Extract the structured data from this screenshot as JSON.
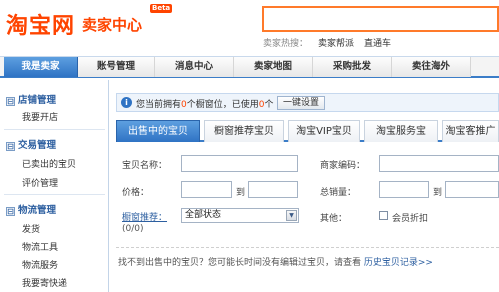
{
  "header": {
    "logo": "淘宝网",
    "subtitle": "卖家中心",
    "beta": "Beta",
    "search_value": "",
    "hot_label": "卖家热搜：",
    "hot_links": [
      "卖家帮派",
      "直通车"
    ]
  },
  "nav": {
    "tabs": [
      "我是卖家",
      "账号管理",
      "消息中心",
      "卖家地图",
      "采购批发",
      "卖往海外"
    ],
    "active": "我是卖家"
  },
  "sidebar": {
    "sections": [
      {
        "title": "店铺管理",
        "toggle": "⊟",
        "items": [
          "我要开店"
        ]
      },
      {
        "title": "交易管理",
        "toggle": "⊟",
        "items": [
          "已卖出的宝贝",
          "评价管理"
        ]
      },
      {
        "title": "物流管理",
        "toggle": "⊟",
        "items": [
          "发货",
          "物流工具",
          "物流服务",
          "我要寄快递"
        ]
      }
    ]
  },
  "notice": {
    "icon": "info-icon",
    "text_before": "您当前拥有",
    "count1": "0",
    "text_mid": "个橱窗位，已使用",
    "count2": "0",
    "text_after": "个",
    "button": "一键设置"
  },
  "tabs": [
    "出售中的宝贝",
    "橱窗推荐宝贝",
    "淘宝VIP宝贝",
    "淘宝服务宝",
    "淘宝客推广"
  ],
  "form": {
    "name_label": "宝贝名称：",
    "code_label": "商家编码：",
    "price_label": "价格：",
    "to1": "到",
    "sales_label": "总销量：",
    "to2": "到",
    "window_label": "橱窗推荐：",
    "window_count": "(0/0)",
    "window_select": "全部状态",
    "other_label": "其他：",
    "member_discount": "会员折扣"
  },
  "tip": {
    "text": "找不到出售中的宝贝？您可能长时间没有编辑过宝贝，请查看",
    "link": "历史宝贝记录>>"
  }
}
